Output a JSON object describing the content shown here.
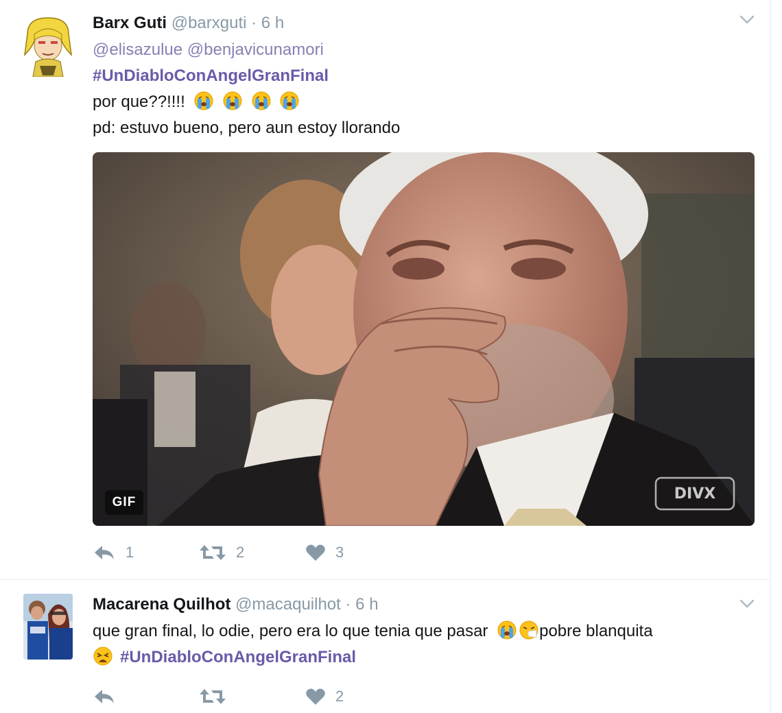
{
  "colors": {
    "hashtag": "#6a5aa8",
    "mention": "#8a7fb3",
    "muted": "#8899a6"
  },
  "tweets": [
    {
      "fullname": "Barx Guti",
      "handle": "@barxguti",
      "dot": "·",
      "time": "6 h",
      "mentions": "@elisazulue @benjavicunamori",
      "hashtag": "#UnDiabloConAngelGranFinal",
      "line1": "por que??!!!!",
      "line1_emojis": [
        "crying-face",
        "crying-face",
        "crying-face",
        "crying-face"
      ],
      "line2": "pd: estuvo bueno, pero aun estoy llorando",
      "media": {
        "badge": "GIF",
        "watermark": "DIVX"
      },
      "actions": {
        "reply_count": "1",
        "retweet_count": "2",
        "like_count": "3"
      }
    },
    {
      "fullname": "Macarena Quilhot",
      "handle": "@macaquilhot",
      "dot": "·",
      "time": "6 h",
      "text_a": "que gran final, lo odie, pero era lo que tenia que pasar",
      "text_b": "pobre blanquita",
      "hashtag": "#UnDiabloConAngelGranFinal",
      "emojis": [
        "crying-face",
        "sneezing-face",
        "weary-face"
      ],
      "actions": {
        "reply_count": "",
        "retweet_count": "",
        "like_count": "2"
      }
    }
  ]
}
